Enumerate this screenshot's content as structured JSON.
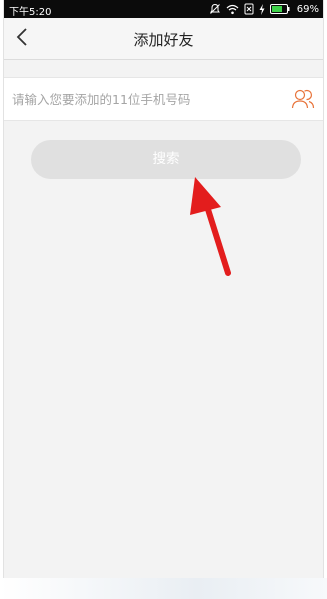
{
  "status_bar": {
    "time": "下午5:20",
    "battery": "69%",
    "icons": [
      "mute-icon",
      "wifi-icon",
      "no-sim-icon",
      "charging-icon",
      "battery-icon"
    ]
  },
  "nav": {
    "title": "添加好友",
    "back_icon": "chevron-left-icon"
  },
  "search": {
    "placeholder": "请输入您要添加的11位手机号码",
    "value": "",
    "contacts_icon": "contacts-icon"
  },
  "search_button": {
    "label": "搜索"
  },
  "colors": {
    "accent": "#e8743b",
    "button_disabled": "#e0e0e0",
    "background": "#f3f3f3",
    "annotation_arrow": "#e31d1d"
  }
}
